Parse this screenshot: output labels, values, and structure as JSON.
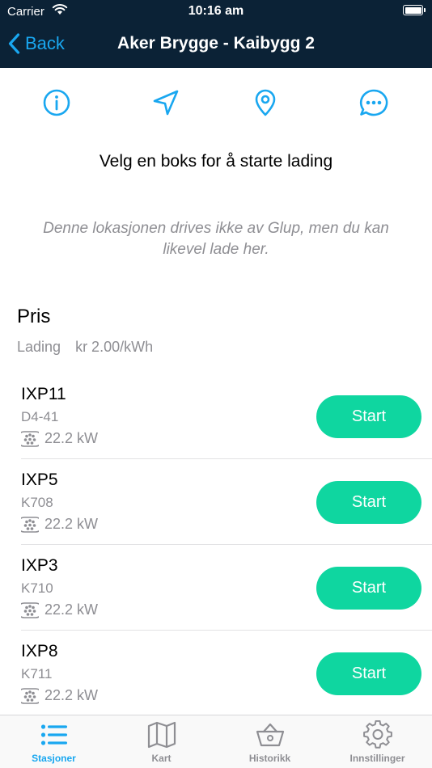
{
  "status_bar": {
    "carrier": "Carrier",
    "time": "10:16 am"
  },
  "nav": {
    "back_label": "Back",
    "title": "Aker Brygge - Kaibygg 2"
  },
  "actions": [
    {
      "icon": "info-icon"
    },
    {
      "icon": "navigation-arrow-icon"
    },
    {
      "icon": "map-pin-icon"
    },
    {
      "icon": "chat-bubble-icon"
    }
  ],
  "prompt": "Velg en boks for å starte lading",
  "notice": "Denne lokasjonen drives ikke av Glup, men du kan likevel lade her.",
  "price": {
    "title": "Pris",
    "label": "Lading",
    "value": "kr 2.00/kWh"
  },
  "chargers": [
    {
      "name": "IXP11",
      "code": "D4-41",
      "power": "22.2 kW",
      "button": "Start"
    },
    {
      "name": "IXP5",
      "code": "K708",
      "power": "22.2 kW",
      "button": "Start"
    },
    {
      "name": "IXP3",
      "code": "K710",
      "power": "22.2 kW",
      "button": "Start"
    },
    {
      "name": "IXP8",
      "code": "K711",
      "power": "22.2 kW",
      "button": "Start"
    }
  ],
  "tabs": [
    {
      "label": "Stasjoner",
      "icon": "list-icon",
      "active": true
    },
    {
      "label": "Kart",
      "icon": "map-icon",
      "active": false
    },
    {
      "label": "Historikk",
      "icon": "basket-icon",
      "active": false
    },
    {
      "label": "Innstillinger",
      "icon": "gear-icon",
      "active": false
    }
  ],
  "colors": {
    "header_bg": "#0b2236",
    "accent": "#19a7f0",
    "start_button": "#0fd6a0",
    "muted_text": "#8e8e93"
  }
}
